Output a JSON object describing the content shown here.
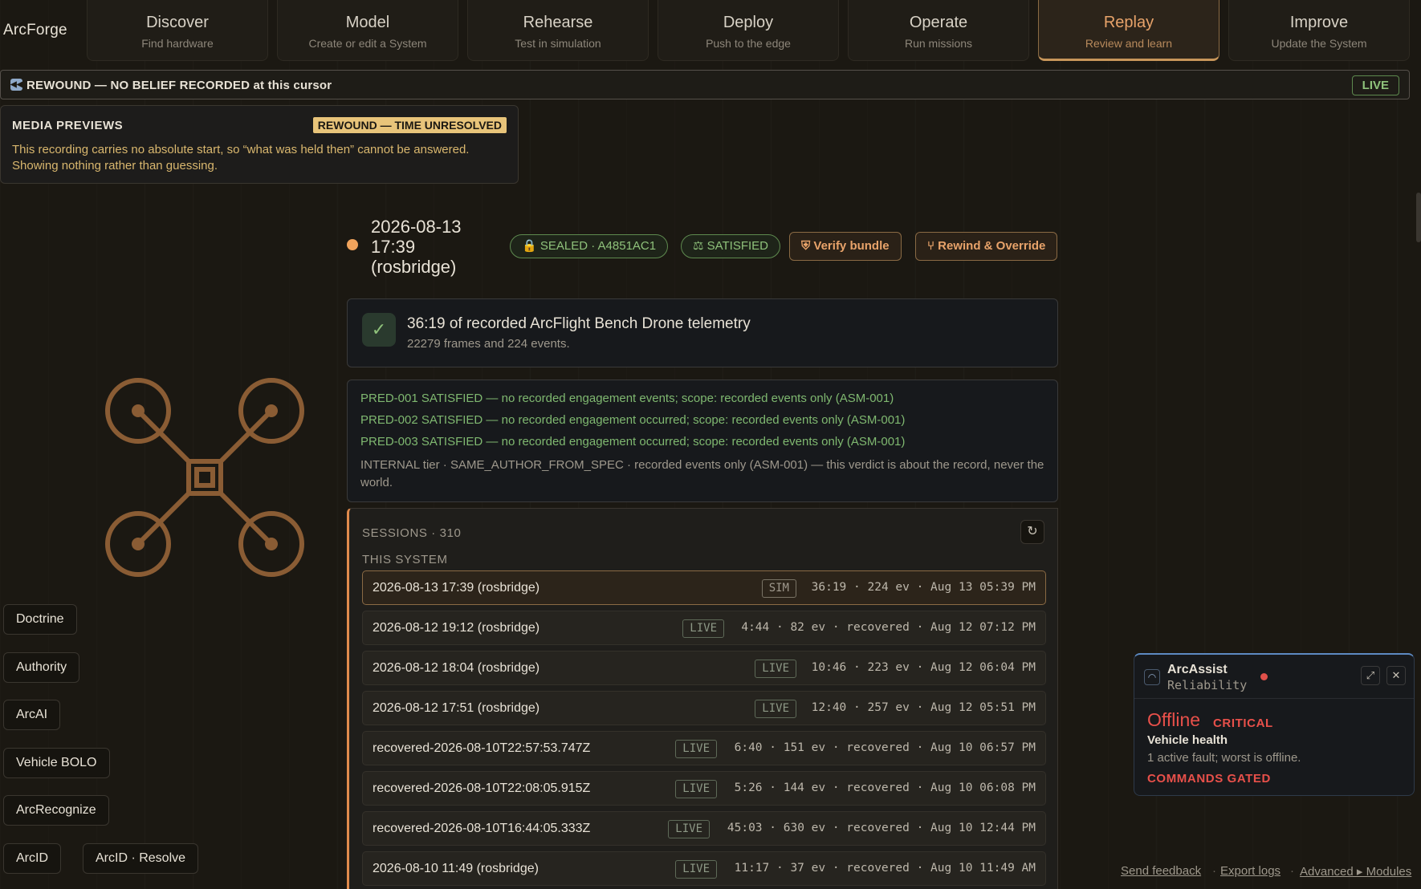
{
  "brand": "ArcForge",
  "nav": [
    {
      "title": "Discover",
      "sub": "Find hardware"
    },
    {
      "title": "Model",
      "sub": "Create or edit a System"
    },
    {
      "title": "Rehearse",
      "sub": "Test in simulation"
    },
    {
      "title": "Deploy",
      "sub": "Push to the edge"
    },
    {
      "title": "Operate",
      "sub": "Run missions"
    },
    {
      "title": "Replay",
      "sub": "Review and learn"
    },
    {
      "title": "Improve",
      "sub": "Update the System"
    }
  ],
  "banner": {
    "icon": "rewind-icon",
    "text": "REWOUND — NO BELIEF RECORDED at this cursor",
    "live": "LIVE"
  },
  "media": {
    "heading": "MEDIA PREVIEWS",
    "tag": "REWOUND — TIME UNRESOLVED",
    "body": "This recording carries no absolute start, so “what was held then” cannot be answered. Showing nothing rather than guessing."
  },
  "session": {
    "title": "2026-08-13 17:39 (rosbridge)",
    "sealed": "🔒 SEALED · A4851AC1",
    "satisfied": "⚖ SATISFIED",
    "verify": "⛨ Verify bundle",
    "rewind": "⑂ Rewind & Override"
  },
  "summary": {
    "title": "36:19 of recorded ArcFlight Bench Drone telemetry",
    "detail": "22279 frames and 224 events."
  },
  "predicates": [
    "PRED-001 SATISFIED — no recorded engagement events; scope: recorded events only (ASM-001)",
    "PRED-002 SATISFIED — no recorded engagement occurred; scope: recorded events only (ASM-001)",
    "PRED-003 SATISFIED — no recorded engagement occurred; scope: recorded events only (ASM-001)"
  ],
  "tier_note": "INTERNAL tier · SAME_AUTHOR_FROM_SPEC · recorded events only (ASM-001) — this verdict is about the record, never the world.",
  "sessions": {
    "heading": "SESSIONS · 310",
    "subheading": "THIS SYSTEM",
    "refresh": "↻",
    "rows": [
      {
        "name": "2026-08-13 17:39 (rosbridge)",
        "kind": "SIM",
        "meta": "36:19 · 224 ev · Aug 13 05:39 PM"
      },
      {
        "name": "2026-08-12 19:12 (rosbridge)",
        "kind": "LIVE",
        "meta": "4:44 · 82 ev · recovered · Aug 12 07:12 PM"
      },
      {
        "name": "2026-08-12 18:04 (rosbridge)",
        "kind": "LIVE",
        "meta": "10:46 · 223 ev · Aug 12 06:04 PM"
      },
      {
        "name": "2026-08-12 17:51 (rosbridge)",
        "kind": "LIVE",
        "meta": "12:40 · 257 ev · Aug 12 05:51 PM"
      },
      {
        "name": "recovered-2026-08-10T22:57:53.747Z",
        "kind": "LIVE",
        "meta": "6:40 · 151 ev · recovered · Aug 10 06:57 PM"
      },
      {
        "name": "recovered-2026-08-10T22:08:05.915Z",
        "kind": "LIVE",
        "meta": "5:26 · 144 ev · recovered · Aug 10 06:08 PM"
      },
      {
        "name": "recovered-2026-08-10T16:44:05.333Z",
        "kind": "LIVE",
        "meta": "45:03 · 630 ev · recovered · Aug 10 12:44 PM"
      },
      {
        "name": "2026-08-10 11:49 (rosbridge)",
        "kind": "LIVE",
        "meta": "11:17 · 37 ev · recovered · Aug 10 11:49 AM"
      }
    ]
  },
  "side_buttons": [
    "Doctrine",
    "Authority",
    "ArcAI",
    "Vehicle BOLO",
    "ArcRecognize",
    "ArcID",
    "ArcID · Resolve"
  ],
  "assist": {
    "name": "ArcAssist",
    "mode": "Reliability",
    "status": "Offline",
    "severity": "CRITICAL",
    "subject": "Vehicle health",
    "detail": "1 active fault; worst is offline.",
    "gate": "COMMANDS GATED",
    "expand": "⤢",
    "close": "✕"
  },
  "footer": {
    "feedback": "Send feedback",
    "export": "Export logs",
    "advanced": "Advanced ▸ Modules"
  },
  "colors": {
    "accent": "#e8a36a",
    "ok": "#8fc27b",
    "critical": "#e8504a",
    "warn": "#d9b76e"
  }
}
